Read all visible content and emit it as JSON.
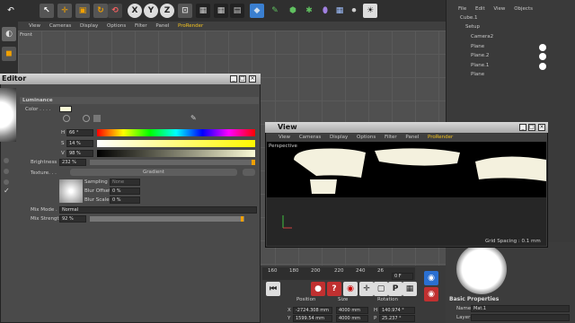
{
  "toolbar": {
    "icons": [
      "undo-icon",
      "live-select-icon",
      "move-icon",
      "scale-icon",
      "rotate-icon",
      "recent-tool-icon",
      "x-axis-icon",
      "y-axis-icon",
      "z-axis-icon",
      "coordinate-system-icon",
      "render-view-icon",
      "render-picture-viewer-icon",
      "edit-render-settings-icon",
      "cube-icon",
      "spline-pen-icon",
      "subdivision-icon",
      "array-icon",
      "deformer-icon",
      "floor-icon",
      "camera-icon",
      "light-icon"
    ],
    "axis_labels": [
      "X",
      "Y",
      "Z"
    ]
  },
  "viewport_bg": {
    "menu": [
      "View",
      "Cameras",
      "Display",
      "Options",
      "Filter",
      "Panel",
      "ProRender"
    ],
    "label": "Front"
  },
  "object_manager": {
    "menu": [
      "File",
      "Edit",
      "View",
      "Objects"
    ],
    "items": [
      "Cube.1",
      "Setup",
      "Camera2",
      "Plane",
      "Plane.2",
      "Plane.1",
      "Plane"
    ]
  },
  "material_editor": {
    "title": "Editor",
    "section": "Luminance",
    "color_label": "Color . . . .",
    "h_label": "H",
    "h_value": "66 °",
    "s_label": "S",
    "s_value": "14 %",
    "v_label": "V",
    "v_value": "98 %",
    "brightness_label": "Brightness",
    "brightness_value": "232 %",
    "texture_label": "Texture. . .",
    "texture_value": "Gradient",
    "sampling_label": "Sampling",
    "sampling_value": "None",
    "blur_offset_label": "Blur Offset",
    "blur_offset_value": "0 %",
    "blur_scale_label": "Blur Scale",
    "blur_scale_value": "0 %",
    "mix_mode_label": "Mix Mode . .",
    "mix_mode_value": "Normal",
    "mix_strength_label": "Mix Strength",
    "mix_strength_value": "92 %"
  },
  "view_window": {
    "title": "View",
    "menu": [
      "View",
      "Cameras",
      "Display",
      "Options",
      "Filter",
      "Panel",
      "ProRender"
    ],
    "camera_label": "Perspective",
    "grid_spacing": "Grid Spacing : 0.1 mm"
  },
  "timeline": {
    "ticks": [
      "160",
      "180",
      "200",
      "220",
      "240",
      "26"
    ],
    "frame": "0 F"
  },
  "coordinates": {
    "headers": [
      "Position",
      "Size",
      "Rotation"
    ],
    "rows": [
      {
        "axis": "X",
        "pos": "-2724.308 mm",
        "size": "4000 mm",
        "rot_label": "H",
        "rot": "140.974 °"
      },
      {
        "axis": "Y",
        "pos": "1599.54 mm",
        "size": "4000 mm",
        "rot_label": "P",
        "rot": "25.237 °"
      }
    ]
  },
  "attributes": {
    "section": "Basic Properties",
    "name_label": "Name",
    "name_value": "Mat.1",
    "layer_label": "Layer"
  },
  "colors": {
    "accent": "#f0c020",
    "bg": "#3a3a3a",
    "panel": "#4a4a4a"
  }
}
